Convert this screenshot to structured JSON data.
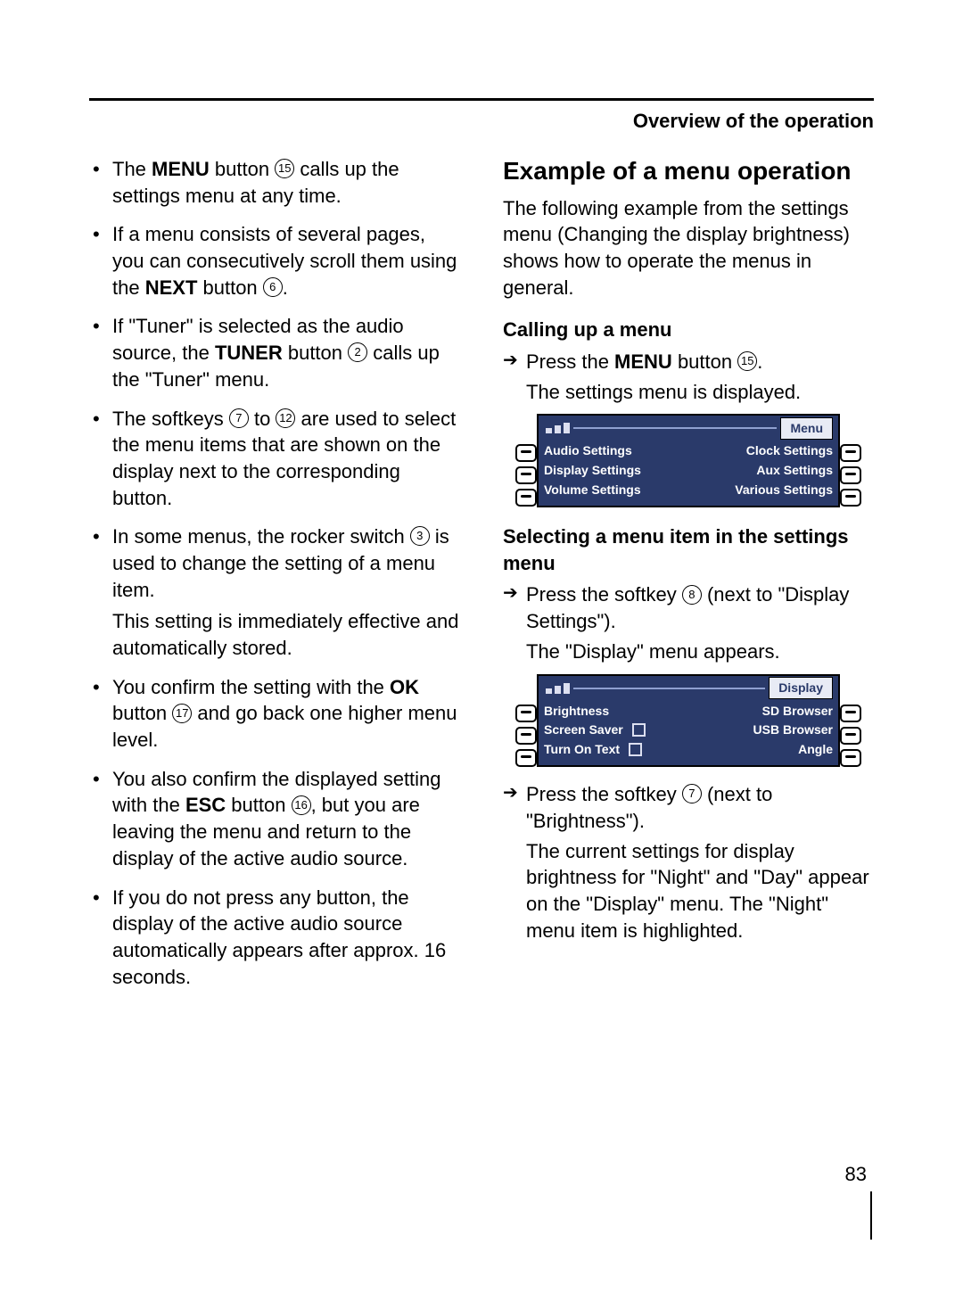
{
  "header": {
    "title": "Overview of the operation"
  },
  "page_number": "83",
  "refs": {
    "r2": "2",
    "r3": "3",
    "r6": "6",
    "r7": "7",
    "r8": "8",
    "r12": "12",
    "r15": "15",
    "r16": "16",
    "r17": "17"
  },
  "left": {
    "b1a": "The ",
    "b1m": "MENU",
    "b1b": " button ",
    "b1c": " calls up the settings menu at any time.",
    "b2a": "If a menu consists of several pages, you can consecutively scroll them using the ",
    "b2m": "NEXT",
    "b2b": " button ",
    "b2c": ".",
    "b3a": "If \"Tuner\" is selected as the audio source, the ",
    "b3m": "TUNER",
    "b3b": " button ",
    "b3c": " calls up the \"Tuner\" menu.",
    "b4a": "The softkeys ",
    "b4b": " to ",
    "b4c": " are used to select the menu items that are shown on the display next to the corresponding button.",
    "b5a": "In some menus, the rocker switch ",
    "b5b": " is used to change the setting of a menu item.",
    "b5sub": "This setting is immediately effective and automatically stored.",
    "b6a": "You confirm the setting with the ",
    "b6m": "OK",
    "b6b": " button ",
    "b6c": " and go back one higher menu level.",
    "b7a": "You also confirm the displayed setting with the ",
    "b7m": "ESC",
    "b7b": " button ",
    "b7c": ", but you are leaving the menu and return to the display of the active audio source.",
    "b8": "If you do not press any button, the display of the active audio source automatically appears after approx. 16 seconds."
  },
  "right": {
    "h2": "Example of a menu operation",
    "intro": "The following example from the settings menu (Changing the display brightness) shows how to operate the menus in general.",
    "h3a": "Calling up a menu",
    "s1a": "Press the ",
    "s1m": "MENU",
    "s1b": " button ",
    "s1c": ".",
    "s1res": "The settings menu is displayed.",
    "h3b": "Selecting a menu item in the settings menu",
    "s2a": "Press the softkey ",
    "s2b": " (next to \"Display Settings\").",
    "s2res": "The \"Display\" menu appears.",
    "s3a": "Press the softkey ",
    "s3b": " (next to \"Brightness\").",
    "s3res": "The current settings for display brightness for \"Night\" and \"Day\" appear on the \"Display\" menu. The \"Night\" menu item is highlighted."
  },
  "menu_screen": {
    "tab": "Menu",
    "left": [
      "Audio   Settings",
      "Display Settings",
      "Volume Settings"
    ],
    "right": [
      "Clock Settings",
      "Aux Settings",
      "Various Settings"
    ]
  },
  "display_screen": {
    "tab": "Display",
    "left": [
      "Brightness",
      "Screen Saver",
      "Turn On Text"
    ],
    "right": [
      "SD Browser",
      "USB Browser",
      "Angle"
    ]
  }
}
